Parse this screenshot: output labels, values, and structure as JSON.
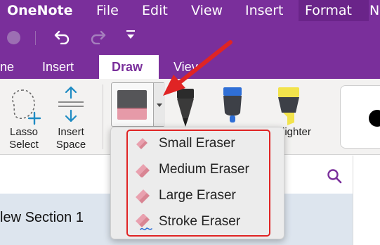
{
  "menubar": {
    "app_name": "OneNote",
    "items": [
      "File",
      "Edit",
      "View",
      "Insert",
      "Format",
      "N"
    ]
  },
  "toolbar": {
    "icons": [
      "window-circle-icon",
      "undo-icon",
      "redo-icon",
      "customize-toolbar-icon"
    ]
  },
  "ribbon_tabs": {
    "items": [
      "ne",
      "Insert",
      "Draw",
      "Viev"
    ],
    "active": "Draw"
  },
  "ribbon": {
    "lasso_label": "Lasso Select",
    "insert_space_label": "Insert Space",
    "highlighter_label": "lighter",
    "pen_colors": {
      "black": "#1f1f1f",
      "blue": "#2f6fd6",
      "yellow": "#f2e34c"
    }
  },
  "eraser_menu": {
    "items": [
      "Small Eraser",
      "Medium Eraser",
      "Large Eraser",
      "Stroke Eraser"
    ],
    "highlight_color": "#e02424"
  },
  "notebook": {
    "section_title": "lew Section 1"
  },
  "colors": {
    "brand": "#7a2f9b",
    "annotation": "#e02424"
  }
}
